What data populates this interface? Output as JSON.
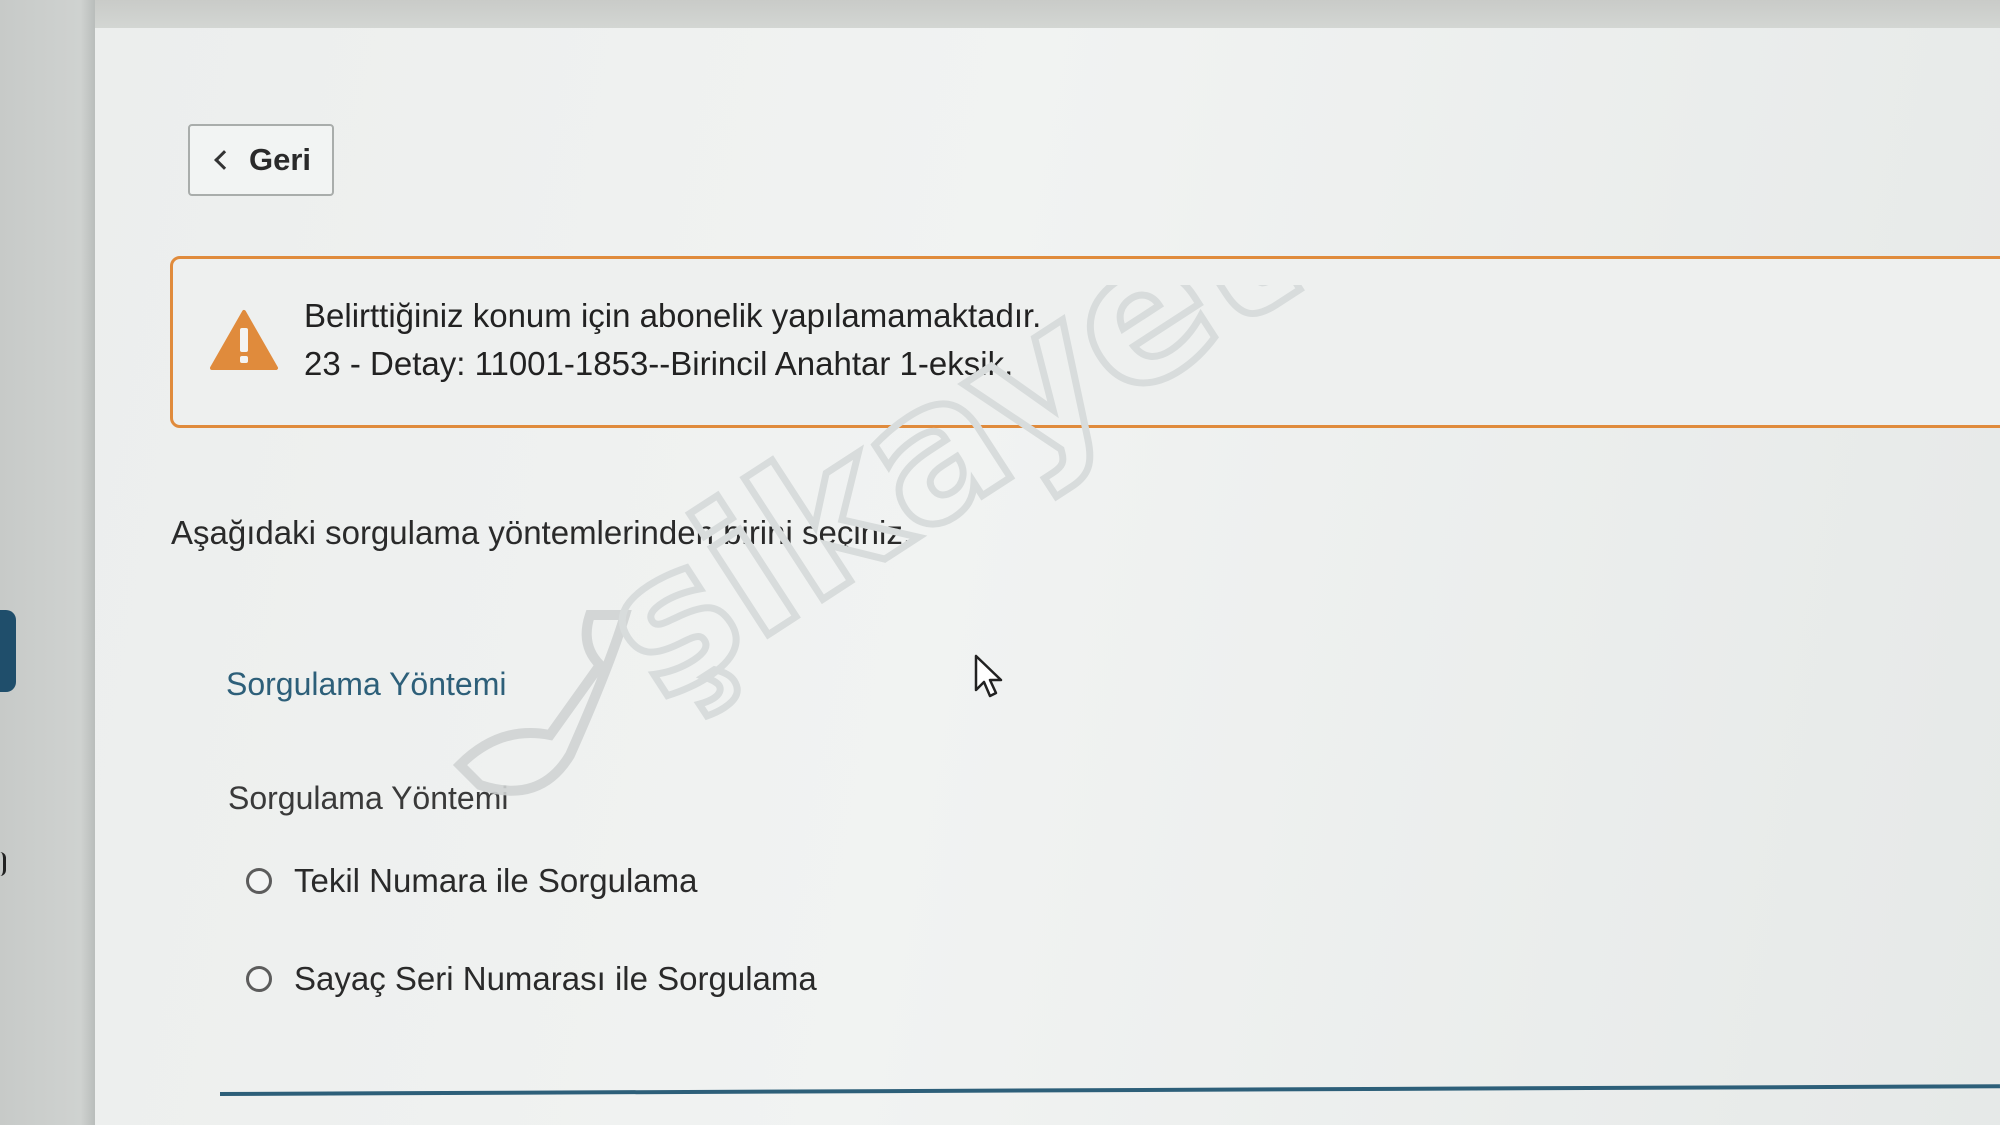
{
  "navigation": {
    "back_label": "Geri"
  },
  "alert": {
    "icon": "warning-triangle-icon",
    "accent_color": "#e08b3c",
    "message": "Belirttiğiniz konum için abonelik yapılamamaktadır.",
    "detail": "23 - Detay: 11001-1853--Birincil Anahtar 1-eksik."
  },
  "instruction": "Aşağıdaki sorgulama yöntemlerinden birini seçiniz.",
  "query_method": {
    "section_title": "Sorgulama Yöntemi",
    "field_label": "Sorgulama Yöntemi",
    "options": [
      {
        "label": "Tekil Numara ile Sorgulama",
        "selected": false
      },
      {
        "label": "Sayaç Seri Numarası ile Sorgulama",
        "selected": false
      }
    ]
  },
  "watermark": "şikayetvar",
  "colors": {
    "section_title": "#2d5f79",
    "alert_border": "#e08b3c"
  }
}
